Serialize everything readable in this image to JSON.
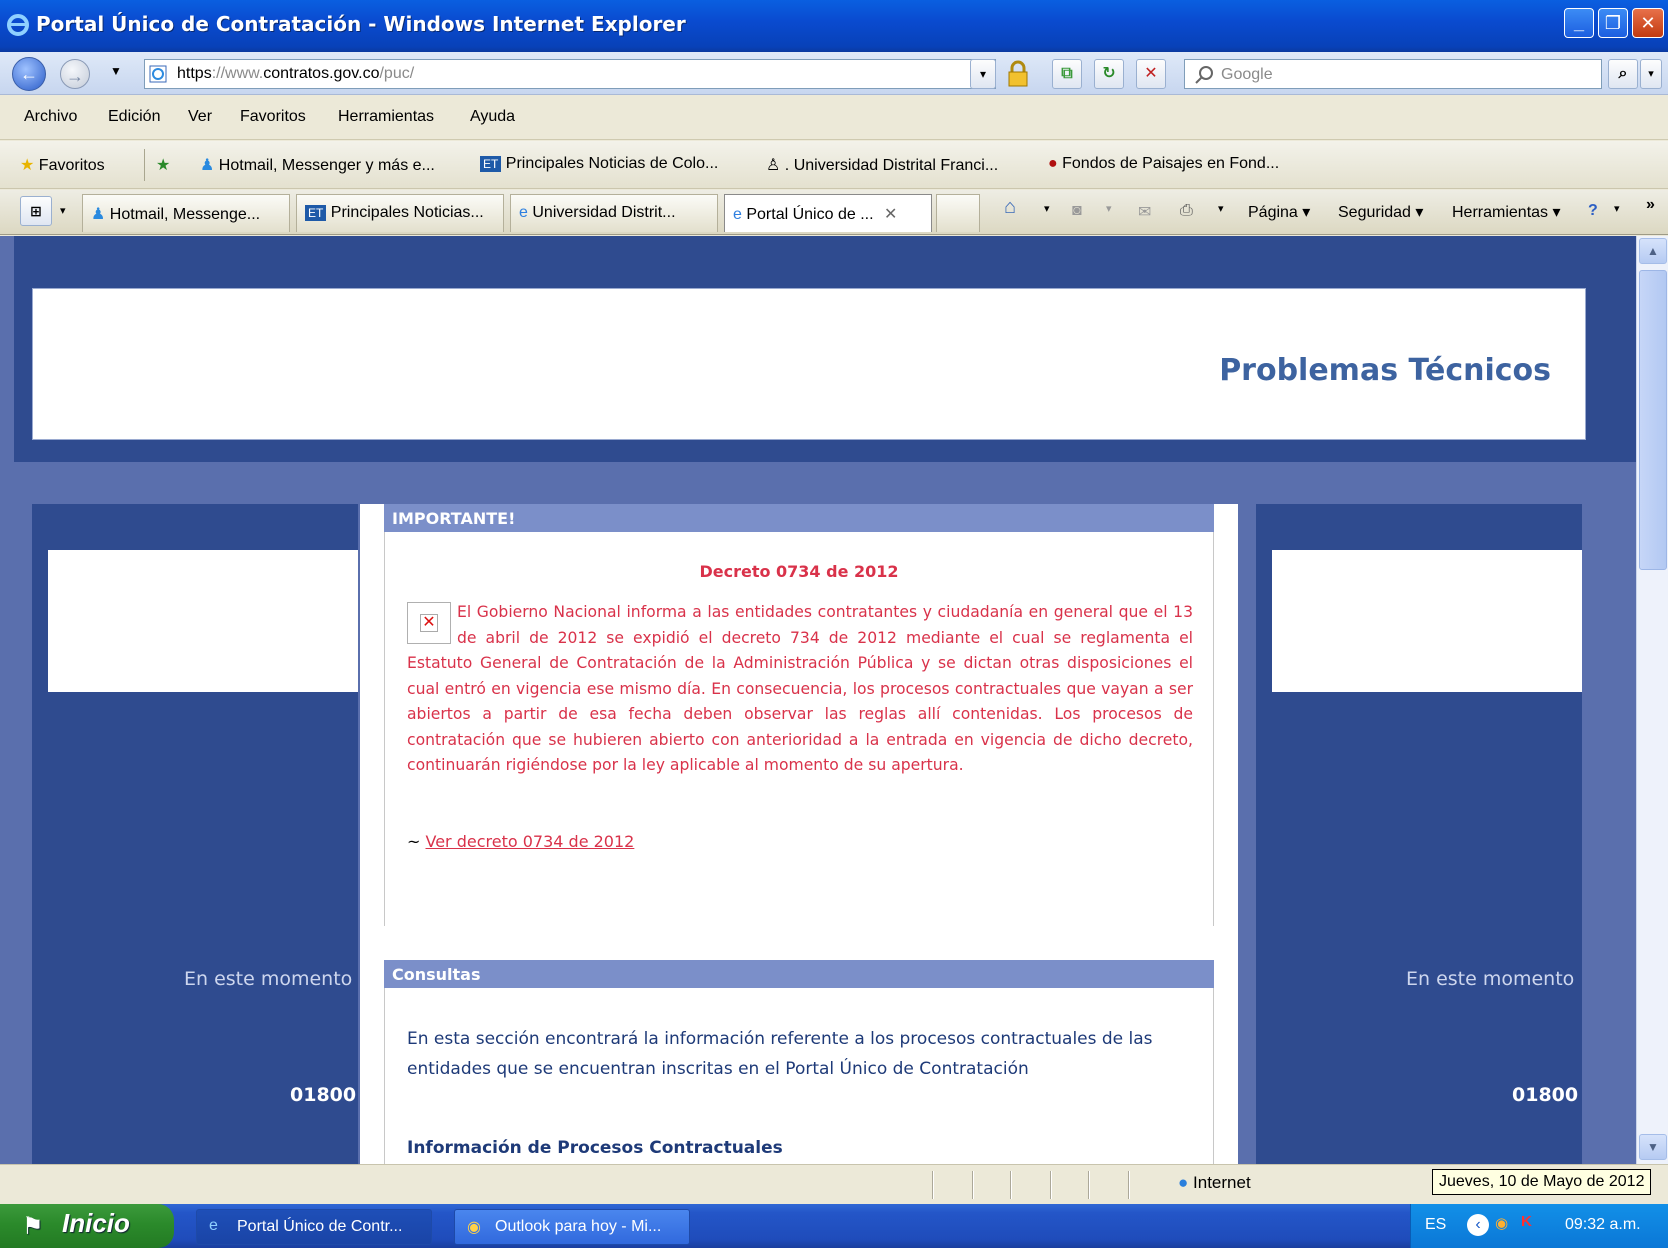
{
  "window": {
    "title": "Portal Único de Contratación - Windows Internet Explorer",
    "buttons": [
      "_",
      "❐",
      "✕"
    ]
  },
  "address_bar": {
    "url_host": "https://www.contratos.gov.co",
    "url_display_pre": "https",
    "url_display_sep": "://www.",
    "url_display_domain": "contratos.gov.co",
    "url_display_path": "/puc/",
    "search_placeholder": "Google"
  },
  "menu": [
    "Archivo",
    "Edición",
    "Ver",
    "Favoritos",
    "Herramientas",
    "Ayuda"
  ],
  "favorites_bar": {
    "favorites_label": "Favoritos",
    "links": [
      "Hotmail, Messenger y más e...",
      "Principales Noticias de Colo...",
      ". Universidad Distrital Franci...",
      "Fondos de Paisajes en Fond..."
    ]
  },
  "tabs": [
    "Hotmail, Messenge...",
    "Principales Noticias...",
    "Universidad Distrit...",
    "Portal Único de ..."
  ],
  "command_bar": {
    "page": "Página ▾",
    "security": "Seguridad ▾",
    "tools": "Herramientas ▾",
    "more": "»"
  },
  "page": {
    "header_title": "Problemas Técnicos",
    "side_text": "En este momento",
    "side_phone": "01800",
    "importante": {
      "heading": "IMPORTANTE!",
      "title": "Decreto 0734 de 2012",
      "body": "El Gobierno Nacional informa a las entidades contratantes y ciudadanía en general que el 13 de abril de 2012 se expidió el decreto 734 de 2012 mediante el cual se reglamenta el Estatuto General de Contratación de la Administración Pública y se dictan otras disposiciones el cual entró en vigencia ese mismo día. En consecuencia, los procesos contractuales que vayan a ser abiertos a partir de esa fecha deben observar las reglas allí contenidas. Los procesos de contratación que se hubieren abierto con anterioridad a la entrada en vigencia de dicho decreto, continuarán rigiéndose por la ley aplicable al momento de su apertura.",
      "link_prefix": "~",
      "link_text": "Ver decreto 0734 de 2012"
    },
    "consultas": {
      "heading": "Consultas",
      "text": "En esta sección encontrará la información referente a los procesos contractuales de las entidades que se encuentran inscritas en el Portal Único de Contratación",
      "subheading": "Información de Procesos Contractuales"
    }
  },
  "status_bar": {
    "zone": "Internet",
    "tooltip": "Jueves, 10 de Mayo de 2012"
  },
  "taskbar": {
    "start": "Inicio",
    "items": [
      "Portal Único de Contr...",
      "Outlook para hoy - Mi..."
    ],
    "lang": "ES",
    "clock": "09:32 a.m."
  },
  "colors": {
    "page_bg": "#5a6fad",
    "header_band": "#2f4b8f",
    "title_blue": "#3d63a0",
    "panel_head": "#7b8fc9",
    "alert_red": "#d9324a",
    "text_blue": "#1e3a78"
  }
}
